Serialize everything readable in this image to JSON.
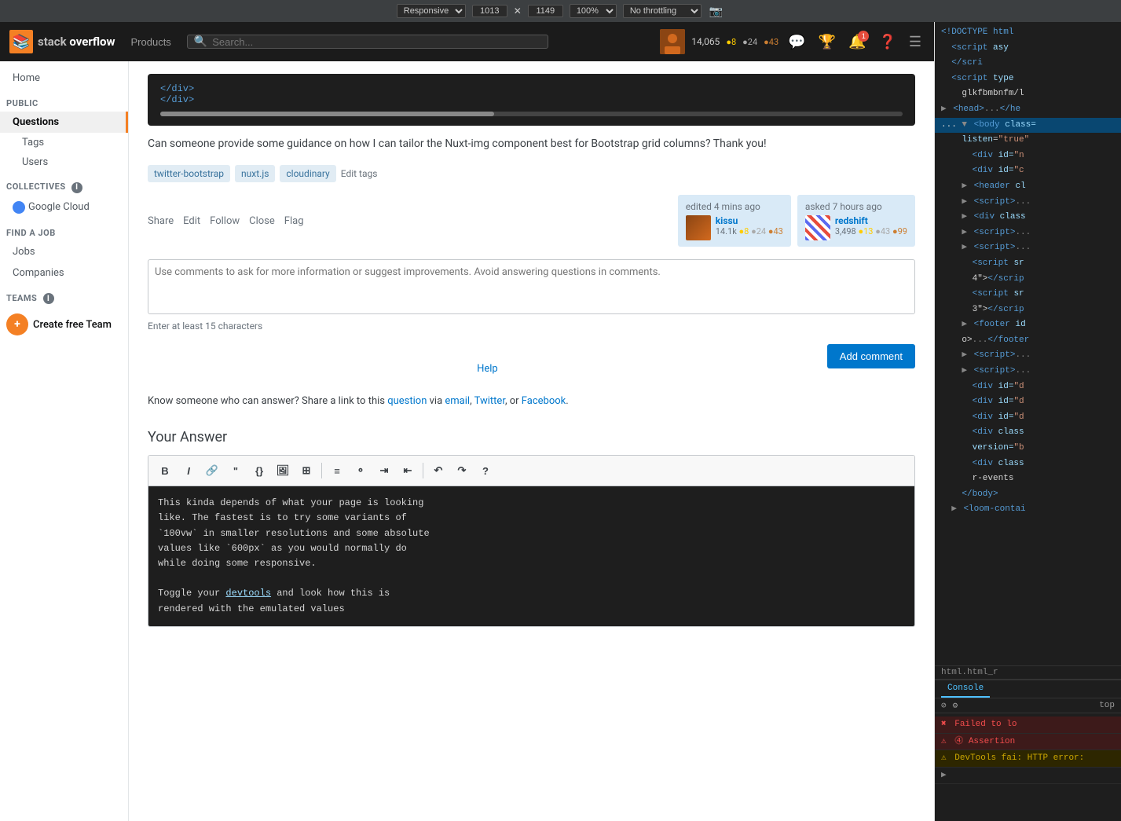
{
  "browser": {
    "mode": "Responsive",
    "width": "1013",
    "height": "1149",
    "zoom": "100%",
    "throttling": "No throttling",
    "camera_icon": "📷"
  },
  "header": {
    "logo_text": "stack overflow",
    "products_label": "Products",
    "search_placeholder": "Search...",
    "user_rep": "14,065",
    "badge_gold": "●8",
    "badge_silver": "●24",
    "badge_bronze": "●43"
  },
  "sidebar": {
    "home_label": "Home",
    "public_header": "PUBLIC",
    "questions_label": "Questions",
    "tags_label": "Tags",
    "users_label": "Users",
    "collectives_header": "COLLECTIVES",
    "google_cloud_label": "Google Cloud",
    "find_job_header": "FIND A JOB",
    "jobs_label": "Jobs",
    "companies_label": "Companies",
    "teams_header": "TEAMS",
    "create_team_label": "Create free Team"
  },
  "question": {
    "code_lines": [
      "  </div>",
      "</div>"
    ],
    "text": "Can someone provide some guidance on how I can tailor the Nuxt-img component best for Bootstrap grid columns? Thank you!",
    "tags": [
      "twitter-bootstrap",
      "nuxt.js",
      "cloudinary"
    ],
    "edit_tags_label": "Edit tags",
    "actions": [
      "Share",
      "Edit",
      "Follow",
      "Close",
      "Flag"
    ],
    "edited_text": "edited 4 mins ago",
    "editor_name": "kissu",
    "editor_rep": "14.1k",
    "editor_gold": "●8",
    "editor_silver": "●24",
    "editor_bronze": "●43",
    "asked_text": "asked 7 hours ago",
    "asker_name": "redshift",
    "asker_rep": "3,498",
    "asker_gold": "●13",
    "asker_silver": "●43",
    "asker_bronze": "●99"
  },
  "comment": {
    "placeholder": "Use comments to ask for more information or suggest improvements. Avoid answering questions in comments.",
    "hint": "Enter at least 15 characters",
    "add_button_label": "Add comment",
    "help_link_label": "Help"
  },
  "share_section": {
    "know_text": "Know someone who can answer? Share a link to this",
    "question_link": "question",
    "via_text": "via",
    "email_link": "email",
    "twitter_link": "Twitter",
    "or_text": "or",
    "facebook_link": "Facebook",
    "period": "."
  },
  "answer_editor": {
    "heading": "Your Answer",
    "toolbar_buttons": [
      "B",
      "I",
      "🔗",
      "\"",
      "{}",
      "🖼",
      "±",
      "≡",
      "⚬",
      "≡",
      "⌶",
      "≡",
      "↶",
      "↷",
      "?"
    ],
    "content_lines": [
      "This kinda depends of what your page is looking",
      "like. The fastest is to try some variants of",
      "`100vw` in smaller resolutions and some absolute",
      "values like `600px` as you would normally do",
      "while doing some responsive.",
      "",
      "Toggle your devtools and look how this is",
      "rendered with the emulated values"
    ]
  },
  "devtools": {
    "code_lines": [
      "<!DOCTYPE html",
      "  <script asy",
      "  </scri",
      "  <script type",
      "    glkfbmbnfm/l",
      "▶ <head>...</he",
      "... ▼ <body class=",
      "    listen=\"true\"",
      "      <div id=\"n",
      "      <div id=\"c",
      "    ▶ <header cl",
      "    ▶ <script>...",
      "    ▶ <div class",
      "    ▶ <script>...",
      "    ▶ <script>...",
      "      <script sr",
      "      4\"></scrip",
      "      <script sr",
      "      3\"></scrip",
      "    ▶ <footer id",
      "    o>...</footer",
      "    ▶ <script>...",
      "    ▶ <script>...",
      "      <div id=\"d",
      "      <div id=\"d",
      "      <div id=\"d",
      "      <div class",
      "      version=\"b",
      "      <div class",
      "      r-events",
      "    </body>",
      "  ▶ <loom-contai"
    ],
    "bottom_line": "  html.html_r",
    "console": {
      "tabs": [
        "Console"
      ],
      "top_label": "top",
      "filter_icon": "⊘",
      "messages": [
        {
          "type": "error",
          "text": "Failed to lo"
        },
        {
          "type": "error",
          "text": "⓸ Assertion"
        },
        {
          "type": "warning",
          "text": "DevTools fai: HTTP error:"
        }
      ]
    }
  }
}
